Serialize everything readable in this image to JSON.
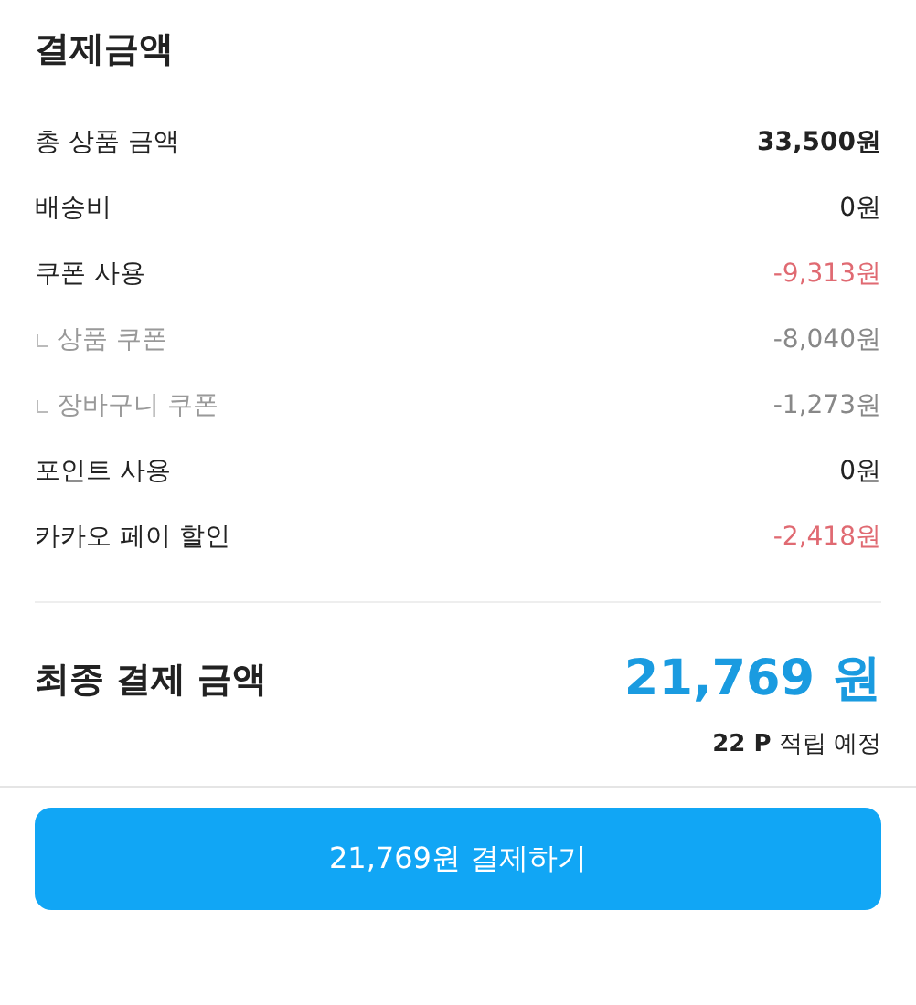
{
  "title": "결제금액",
  "rows": [
    {
      "kind": "main",
      "label": "총 상품 금액",
      "value": "33,500원",
      "bold": true,
      "discount": false
    },
    {
      "kind": "main",
      "label": "배송비",
      "value": "0원",
      "bold": false,
      "discount": false
    },
    {
      "kind": "main",
      "label": "쿠폰 사용",
      "value": "-9,313원",
      "bold": false,
      "discount": true
    },
    {
      "kind": "sub",
      "label": "상품 쿠폰",
      "value": "-8,040원",
      "bold": false,
      "discount": false
    },
    {
      "kind": "sub",
      "label": "장바구니 쿠폰",
      "value": "-1,273원",
      "bold": false,
      "discount": false
    },
    {
      "kind": "main",
      "label": "포인트 사용",
      "value": "0원",
      "bold": false,
      "discount": false
    },
    {
      "kind": "main",
      "label": "카카오 페이 할인",
      "value": "-2,418원",
      "bold": false,
      "discount": true
    }
  ],
  "final": {
    "label": "최종 결제 금액",
    "amount": "21,769 원",
    "points": "22 P",
    "points_note": "적립 예정"
  },
  "pay_button": "21,769원 결제하기"
}
